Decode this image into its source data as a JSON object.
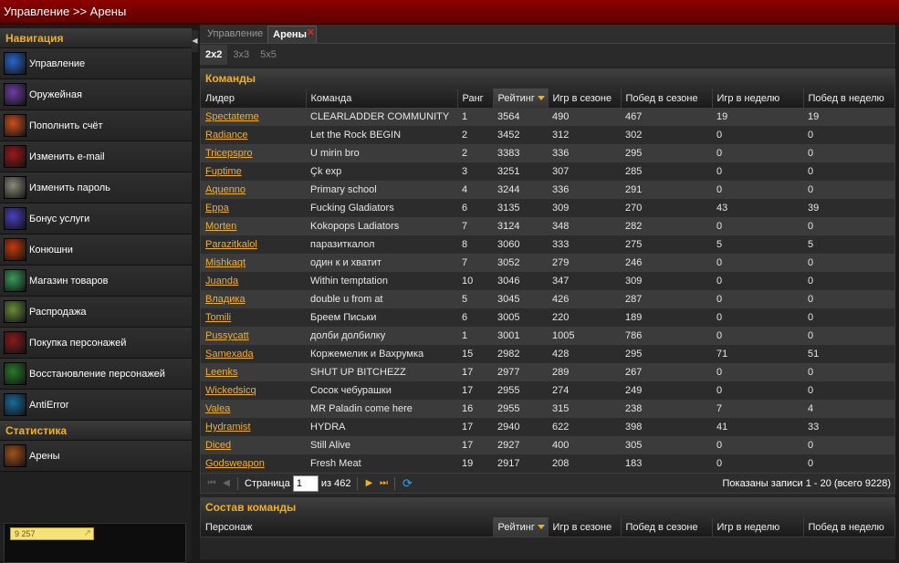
{
  "window": {
    "title": "Управление >> Арены"
  },
  "sidebar": {
    "nav_title": "Навигация",
    "items": [
      {
        "label": "Управление",
        "icon": "manage-icon",
        "color": "#2a66c9"
      },
      {
        "label": "Оружейная",
        "icon": "armory-icon",
        "color": "#6b3fa0"
      },
      {
        "label": "Пополнить счёт",
        "icon": "deposit-icon",
        "color": "#c9501f"
      },
      {
        "label": "Изменить e-mail",
        "icon": "email-icon",
        "color": "#9a1a1a"
      },
      {
        "label": "Изменить пароль",
        "icon": "password-icon",
        "color": "#8a8a7a"
      },
      {
        "label": "Бонус услуги",
        "icon": "bonus-icon",
        "color": "#4a3fbf"
      },
      {
        "label": "Конюшни",
        "icon": "stables-icon",
        "color": "#c23a10"
      },
      {
        "label": "Магазин товаров",
        "icon": "shop-icon",
        "color": "#3a9a5a"
      },
      {
        "label": "Распродажа",
        "icon": "sale-icon",
        "color": "#6a8a3a"
      },
      {
        "label": "Покупка персонажей",
        "icon": "buy-character-icon",
        "color": "#8a1a1a"
      },
      {
        "label": "Восстановление персонажей",
        "icon": "restore-character-icon",
        "color": "#2a7a2a"
      },
      {
        "label": "AntiError",
        "icon": "antierror-icon",
        "color": "#1a6a9a"
      }
    ],
    "stats_title": "Статистика",
    "stats_items": [
      {
        "label": "Арены",
        "icon": "arena-icon",
        "color": "#a0521a"
      }
    ],
    "promo_text": "9 257"
  },
  "tabs": [
    {
      "label": "Управление"
    },
    {
      "label": "Арены"
    }
  ],
  "subtabs": [
    {
      "label": "2x2"
    },
    {
      "label": "3x3"
    },
    {
      "label": "5x5"
    }
  ],
  "teams": {
    "title": "Команды",
    "columns": [
      "Лидер",
      "Команда",
      "Ранг",
      "Рейтинг",
      "Игр в сезоне",
      "Побед в сезоне",
      "Игр в неделю",
      "Побед в неделю"
    ],
    "rows": [
      [
        "Spectateme",
        "CLEARLADDER COMMUNITY",
        "1",
        "3564",
        "490",
        "467",
        "19",
        "19"
      ],
      [
        "Radiance",
        "Let the Rock BEGIN",
        "2",
        "3452",
        "312",
        "302",
        "0",
        "0"
      ],
      [
        "Tricepspro",
        "U mirin bro",
        "2",
        "3383",
        "336",
        "295",
        "0",
        "0"
      ],
      [
        "Fuptime",
        "Çk exp",
        "3",
        "3251",
        "307",
        "285",
        "0",
        "0"
      ],
      [
        "Aquenno",
        "Primary school",
        "4",
        "3244",
        "336",
        "291",
        "0",
        "0"
      ],
      [
        "Eppa",
        "Fucking Gladiators",
        "6",
        "3135",
        "309",
        "270",
        "43",
        "39"
      ],
      [
        "Morten",
        "Kokopops Ladiators",
        "7",
        "3124",
        "348",
        "282",
        "0",
        "0"
      ],
      [
        "Parazitkalol",
        "паразиткалол",
        "8",
        "3060",
        "333",
        "275",
        "5",
        "5"
      ],
      [
        "Mishkaqt",
        "один к и хватит",
        "7",
        "3052",
        "279",
        "246",
        "0",
        "0"
      ],
      [
        "Juanda",
        "Within temptation",
        "10",
        "3046",
        "347",
        "309",
        "0",
        "0"
      ],
      [
        "Владика",
        "double u from at",
        "5",
        "3045",
        "426",
        "287",
        "0",
        "0"
      ],
      [
        "Tomili",
        "Бреем Письки",
        "6",
        "3005",
        "220",
        "189",
        "0",
        "0"
      ],
      [
        "Pussycatt",
        "долби долбилку",
        "1",
        "3001",
        "1005",
        "786",
        "0",
        "0"
      ],
      [
        "Samexada",
        "Коржемелик и Вахрумка",
        "15",
        "2982",
        "428",
        "295",
        "71",
        "51"
      ],
      [
        "Leenks",
        "SHUT UP BITCHEZZ",
        "17",
        "2977",
        "289",
        "267",
        "0",
        "0"
      ],
      [
        "Wickedsicq",
        "Сосок чебурашки",
        "17",
        "2955",
        "274",
        "249",
        "0",
        "0"
      ],
      [
        "Valea",
        "MR Paladin come here",
        "16",
        "2955",
        "315",
        "238",
        "7",
        "4"
      ],
      [
        "Hydramist",
        "HYDRA",
        "17",
        "2940",
        "622",
        "398",
        "41",
        "33"
      ],
      [
        "Diced",
        "Still Alive",
        "17",
        "2927",
        "400",
        "305",
        "0",
        "0"
      ],
      [
        "Godsweapon",
        "Fresh Meat",
        "19",
        "2917",
        "208",
        "183",
        "0",
        "0"
      ]
    ]
  },
  "pager": {
    "page_label": "Страница",
    "page_value": "1",
    "of_label": "из 462",
    "info": "Показаны записи 1 - 20 (всего 9228)"
  },
  "roster": {
    "title": "Состав команды",
    "columns": [
      "Персонаж",
      "Рейтинг",
      "Игр в сезоне",
      "Побед в сезоне",
      "Игр в неделю",
      "Побед в неделю"
    ]
  },
  "colors": {
    "accent": "#f1b021",
    "titlebar": "#7a0000",
    "refresh": "#3aa0e8"
  }
}
